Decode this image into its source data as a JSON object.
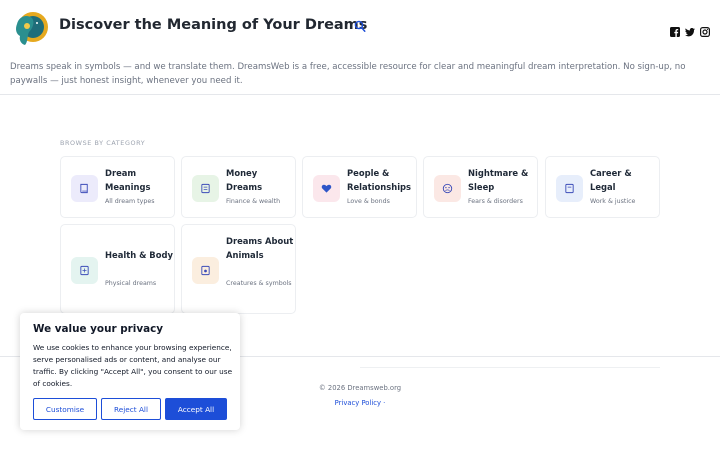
{
  "header": {
    "title": "Discover the Meaning of Your Dreams",
    "intro": "Dreams speak in symbols — and we translate them. DreamsWeb is a free, accessible resource for clear and meaningful dream interpretation. No sign-up, no paywalls — just honest insight, whenever you need it."
  },
  "section_label": "BROWSE BY CATEGORY",
  "categories": [
    {
      "title": "Dream Meanings",
      "subtitle": "All dream types",
      "icon": "book-icon",
      "bg": "#ecebfb"
    },
    {
      "title": "Money Dreams",
      "subtitle": "Finance & wealth",
      "icon": "money-icon",
      "bg": "#e7f4e6"
    },
    {
      "title": "People & Relationships",
      "subtitle": "Love & bonds",
      "icon": "heart-icon",
      "bg": "#fbe7ec"
    },
    {
      "title": "Nightmare & Sleep",
      "subtitle": "Fears & disorders",
      "icon": "nightmare-icon",
      "bg": "#fbe8e4"
    },
    {
      "title": "Career & Legal",
      "subtitle": "Work & justice",
      "icon": "briefcase-icon",
      "bg": "#e7eefb"
    },
    {
      "title": "Health & Body",
      "subtitle": "Physical dreams",
      "icon": "health-icon",
      "bg": "#e4f4f0"
    },
    {
      "title": "Dreams About Animals",
      "subtitle": "Creatures & symbols",
      "icon": "paw-icon",
      "bg": "#fbeedf"
    }
  ],
  "footer": {
    "copyright": "© 2026 Dreamsweb.org",
    "policy": "Privacy Policy ·"
  },
  "cookie": {
    "title": "We value your privacy",
    "text": "We use cookies to enhance your browsing experience, serve personalised ads or content, and analyse our traffic. By clicking \"Accept All\", you consent to our use of cookies.",
    "customise": "Customise",
    "reject": "Reject All",
    "accept": "Accept All"
  },
  "colors": {
    "accent": "#1d4ed8",
    "heart": "#2f56c8"
  }
}
